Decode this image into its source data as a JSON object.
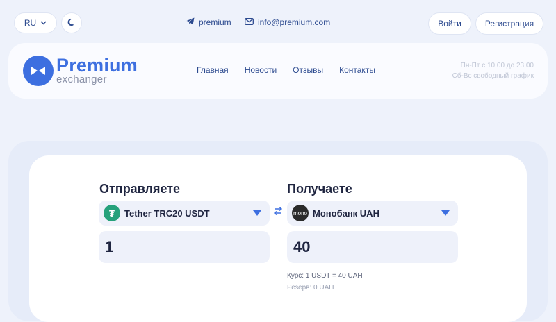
{
  "topbar": {
    "language": "RU",
    "telegram_label": "premium",
    "email_label": "info@premium.com",
    "login_label": "Войти",
    "register_label": "Регистрация"
  },
  "header": {
    "logo_title": "Premium",
    "logo_subtitle": "exchanger",
    "nav": [
      "Главная",
      "Новости",
      "Отзывы",
      "Контакты"
    ],
    "hours_line1": "Пн-Пт с 10:00 до 23:00",
    "hours_line2": "Сб-Вс свободный график"
  },
  "exchange": {
    "send_title": "Отправляете",
    "receive_title": "Получаете",
    "send_currency": "Tether TRC20 USDT",
    "receive_currency": "Монобанк UAH",
    "send_icon_text": "₮",
    "receive_icon_text": "mono",
    "send_amount": "1",
    "receive_amount": "40",
    "rate": "Курс: 1 USDT = 40 UAH",
    "reserve": "Резерв: 0 UAH"
  },
  "colors": {
    "accent": "#3d6fe0",
    "tether": "#26a17b",
    "background": "#eef2fb"
  },
  "icons": [
    "chevron-down-icon",
    "moon-icon",
    "telegram-icon",
    "mail-icon",
    "logo-icon",
    "swap-icon",
    "caret-down-icon"
  ]
}
